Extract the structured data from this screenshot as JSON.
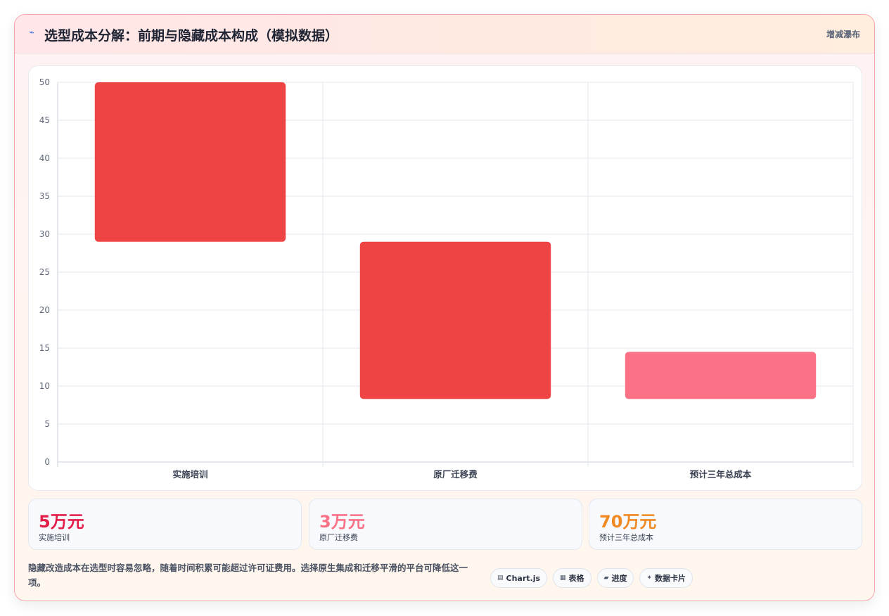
{
  "header": {
    "icon": "lightning-icon",
    "title": "选型成本分解：前期与隐藏成本构成（模拟数据）",
    "action_label": "增减瀑布"
  },
  "chart_data": {
    "type": "bar",
    "subtype": "waterfall",
    "categories": [
      "实施培训",
      "原厂迁移费",
      "预计三年总成本"
    ],
    "ranges": [
      [
        29,
        50
      ],
      [
        8.3,
        29
      ],
      [
        8.3,
        14.5
      ]
    ],
    "colors": [
      "#ef4444",
      "#ef4444",
      "#fb7185"
    ],
    "ylim": [
      0,
      50
    ],
    "yticks": [
      0,
      5,
      10,
      15,
      20,
      25,
      30,
      35,
      40,
      45,
      50
    ],
    "grid": true,
    "legend": "none"
  },
  "stats": [
    {
      "value": "5万元",
      "label": "实施培训",
      "color": "#e11d48"
    },
    {
      "value": "3万元",
      "label": "原厂迁移费",
      "color": "#f87187"
    },
    {
      "value": "70万元",
      "label": "预计三年总成本",
      "color": "#f08a24"
    }
  ],
  "note": "隐藏改造成本在选型时容易忽略，随着时间积累可能超过许可证费用。选择原生集成和迁移平滑的平台可降低这一项。",
  "pills": [
    {
      "icon": "chart-icon",
      "glyph": "▤",
      "label": "Chart.js"
    },
    {
      "icon": "table-icon",
      "glyph": "▦",
      "label": "表格"
    },
    {
      "icon": "progress-icon",
      "glyph": "▰",
      "label": "进度"
    },
    {
      "icon": "sparkle-icon",
      "glyph": "✦",
      "label": "数据卡片"
    }
  ]
}
